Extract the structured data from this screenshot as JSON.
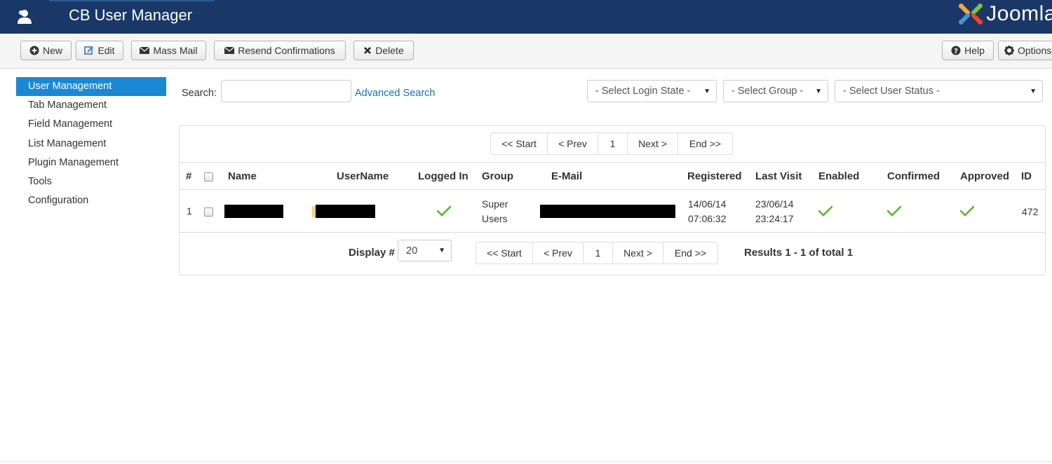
{
  "header": {
    "title": "CB User Manager",
    "app_icon": "users-icon",
    "brand": "Joomla",
    "brand_icon": "joomla-logo-icon",
    "brand_partial_glyph": "!"
  },
  "toolbar": {
    "new_label": "New",
    "edit_label": "Edit",
    "mass_mail_label": "Mass Mail",
    "resend_label": "Resend Confirmations",
    "delete_label": "Delete",
    "help_label": "Help",
    "options_label": "Options"
  },
  "sidebar": {
    "items": [
      {
        "label": "User Management",
        "active": true
      },
      {
        "label": "Tab Management"
      },
      {
        "label": "Field Management"
      },
      {
        "label": "List Management"
      },
      {
        "label": "Plugin Management"
      },
      {
        "label": "Tools"
      },
      {
        "label": "Configuration"
      }
    ]
  },
  "filters": {
    "search_label": "Search:",
    "search_value": "",
    "advanced_search": "Advanced Search",
    "login_state": "- Select Login State -",
    "group": "- Select Group -",
    "user_status": "- Select User Status -"
  },
  "pagination": {
    "start": "<< Start",
    "prev": "< Prev",
    "page": "1",
    "next": "Next >",
    "end": "End >>"
  },
  "table": {
    "headers": [
      "#",
      "Name",
      "UserName",
      "Logged In",
      "Group",
      "E-Mail",
      "Registered",
      "Last Visit",
      "Enabled",
      "Confirmed",
      "Approved",
      "ID"
    ],
    "rows": [
      {
        "num": "1",
        "group_line1": "Super",
        "group_line2": "Users",
        "registered_date": "14/06/14",
        "registered_time": "07:06:32",
        "last_visit_date": "23/06/14",
        "last_visit_time": "23:24:17",
        "id": "472",
        "logged_in": true,
        "enabled": true,
        "confirmed": true,
        "approved": true
      }
    ]
  },
  "footer": {
    "display_label": "Display #",
    "display_value": "20",
    "results": "Results 1 - 1 of total 1"
  },
  "colors": {
    "header_bg": "#1a3867",
    "active_item": "#1b88d4",
    "link": "#1b6fb4",
    "check": "#5cb82b"
  }
}
